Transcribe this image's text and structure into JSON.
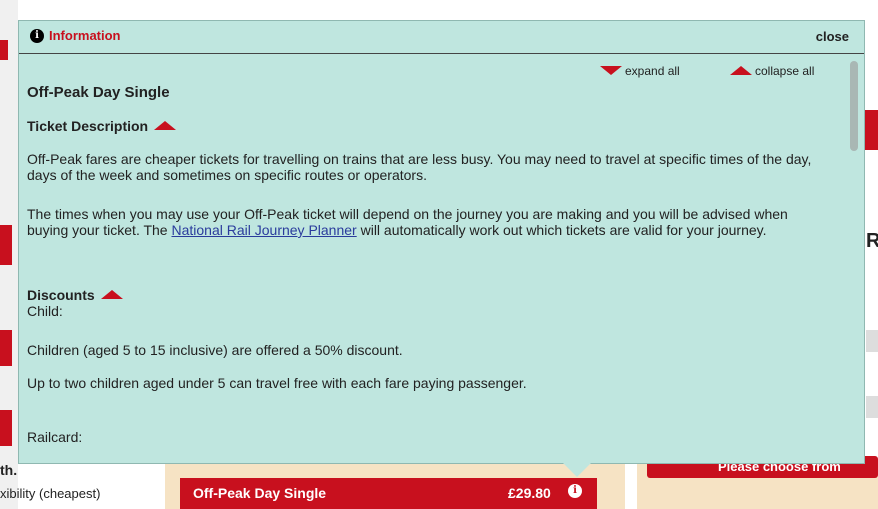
{
  "background": {
    "left_heading": "th.",
    "left_option_1": "xibility (cheapest)",
    "bottom_ticket": {
      "name": "Off-Peak Day Single",
      "price": "£29.80"
    },
    "right_cta": "Please choose from"
  },
  "popup": {
    "title": "Information",
    "close_label": "close",
    "expand_label": "expand all",
    "collapse_label": "collapse all",
    "ticket_name": "Off-Peak Day Single",
    "description_heading": "Ticket Description",
    "description_p1": "Off-Peak fares are cheaper tickets for travelling on trains that are less busy. You may need to travel at specific times of the day, days of the week and sometimes on specific routes or operators.",
    "description_p2_before": "The times when you may use your Off-Peak ticket will depend on the journey you are making and you will be advised when buying your ticket. The ",
    "description_p2_link": "National Rail Journey Planner",
    "description_p2_after": " will automatically work out which tickets are valid for your journey.",
    "discounts_heading": "Discounts",
    "child_label": "Child:",
    "child_p1": "Children (aged 5 to 15 inclusive) are offered a 50% discount.",
    "child_p2": "Up to two children aged under 5 can travel free with each fare paying passenger.",
    "railcard_label": "Railcard:"
  }
}
